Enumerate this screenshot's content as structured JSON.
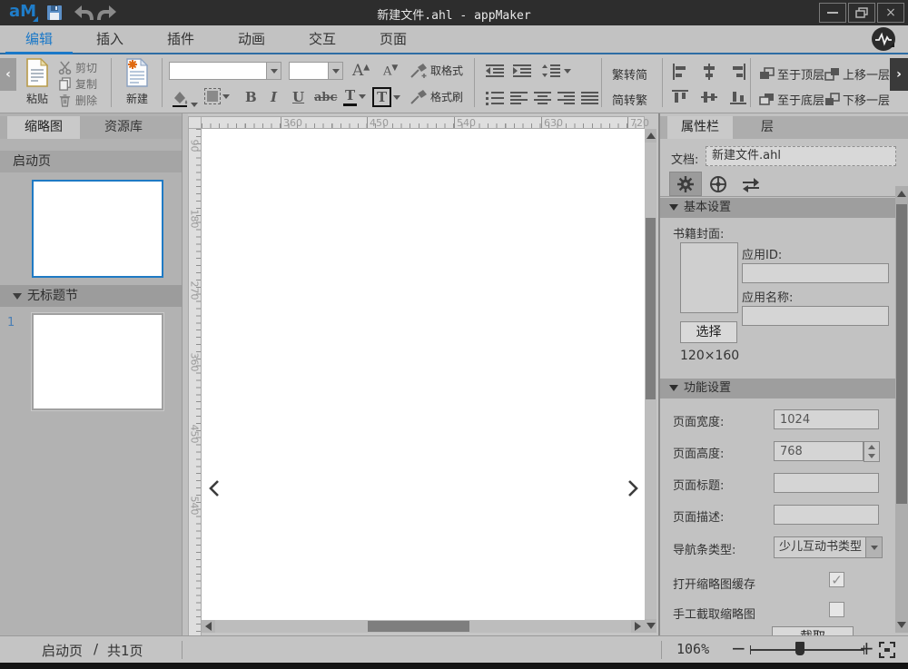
{
  "window": {
    "logo": "aM",
    "title": "新建文件.ahl - appMaker"
  },
  "ribbon_tabs": {
    "edit": "编辑",
    "insert": "插入",
    "plugin": "插件",
    "animation": "动画",
    "interaction": "交互",
    "page": "页面"
  },
  "toolbar": {
    "paste": "粘贴",
    "cut": "剪切",
    "copy": "复制",
    "del": "删除",
    "new": "新建",
    "pick_format": "取格式",
    "format_painter": "格式刷",
    "bold": "B",
    "italic": "I",
    "underline": "U",
    "strike": "abc",
    "text_color": "T",
    "text_frame": "T",
    "t2s": "繁转简",
    "s2t": "简转繁",
    "to_top": "至于顶层",
    "to_bottom": "至于底层",
    "move_up": "上移一层",
    "move_down": "下移一层"
  },
  "left_panel": {
    "tab_thumbnails": "缩略图",
    "tab_resources": "资源库",
    "launch_page": "启动页",
    "section_title": "无标题节",
    "page_number": "1"
  },
  "ruler": {
    "h": [
      "360",
      "450",
      "540",
      "630",
      "720"
    ],
    "v": [
      "90",
      "180",
      "270",
      "360",
      "450",
      "540"
    ]
  },
  "right_panel": {
    "tab_properties": "属性栏",
    "tab_layers": "层",
    "doc_label": "文档:",
    "doc_value": "新建文件.ahl",
    "basic_section": "基本设置",
    "cover_label": "书籍封面:",
    "choose": "选择",
    "cover_size": "120×160",
    "app_id_label": "应用ID:",
    "app_name_label": "应用名称:",
    "function_section": "功能设置",
    "fields": [
      {
        "label": "页面宽度:",
        "value": "1024"
      },
      {
        "label": "页面高度:",
        "value": "768"
      },
      {
        "label": "页面标题:",
        "value": ""
      },
      {
        "label": "页面描述:",
        "value": ""
      }
    ],
    "nav_type_label": "导航条类型:",
    "nav_type_value": "少儿互动书类型",
    "thumb_cache_label": "打开缩略图缓存",
    "thumb_cache_checked": "✓",
    "thumb_manual_label": "手工截取缩略图",
    "capture": "截取"
  },
  "status_bar": {
    "page_name": "启动页",
    "separator": "/",
    "page_count": "共1页",
    "zoom": "106%",
    "zoom_out": "−",
    "zoom_in": "+"
  },
  "colors": {
    "accent_blue": "#1a78c8",
    "titlebar": "#2d2d2d",
    "tab_border": "#2e6da4"
  }
}
